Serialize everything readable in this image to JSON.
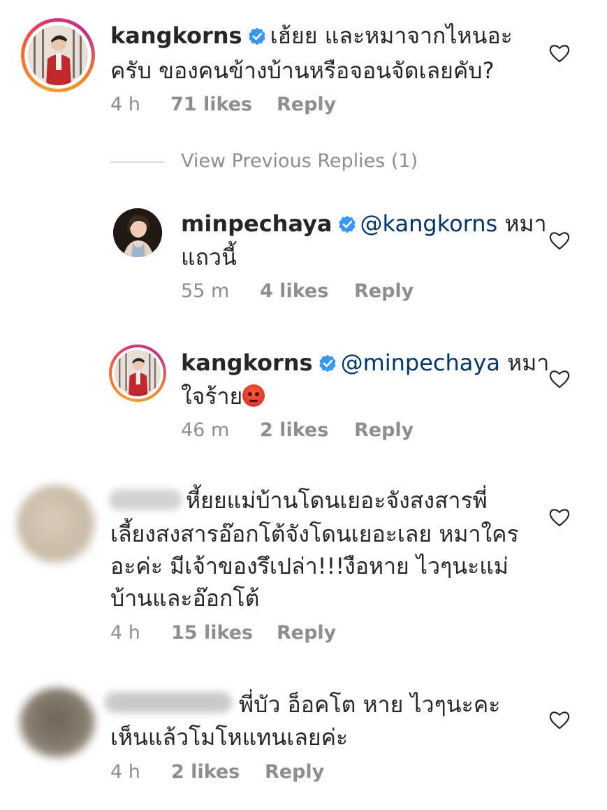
{
  "comments": [
    {
      "username": "kangkorns",
      "verified": true,
      "line1": "เฮ้ยย และหมาจากไหนอะ",
      "line2": "ครับ ของคนข้างบ้านหรือจอนจัดเลยคับ?",
      "time": "4 h",
      "likes": "71 likes",
      "reply": "Reply",
      "icon": "heart-outline-icon"
    }
  ],
  "view_previous": "View Previous Replies (1)",
  "replies": [
    {
      "username": "minpechaya",
      "verified": true,
      "mention": "@kangkorns",
      "line1_rest": " หมา",
      "line2": "แถวนี้",
      "time": "55 m",
      "likes": "4 likes",
      "reply": "Reply"
    },
    {
      "username": "kangkorns",
      "verified": true,
      "mention": "@minpechaya",
      "line1_rest": " หมา",
      "line2": "ใจร้าย",
      "emoji": "angry-face-emoji",
      "time": "46 m",
      "likes": "2 likes",
      "reply": "Reply"
    }
  ],
  "other_comments": [
    {
      "line1": "หี้ยยแม่บ้านโดนเยอะจังสงสารพี่",
      "line2": "เลี้ยงสงสารอ๊อกโต้จังโดนเยอะเลย หมาใคร",
      "line3": "อะค่ะ มีเจ้าของรึเปล่า!!!งือหาย ไวๆนะแม่",
      "line4": "บ้านและอ๊อกโต้",
      "time": "4 h",
      "likes": "15 likes",
      "reply": "Reply"
    },
    {
      "line1": "พี่บัว อ็อคโต หาย ไวๆนะคะ",
      "line2": "เห็นแล้วโมโหแทนเลยค่ะ",
      "time": "4 h",
      "likes": "2 likes",
      "reply": "Reply"
    }
  ],
  "colors": {
    "text": "#262626",
    "meta": "#8e8e8e",
    "mention": "#003569",
    "verified": "#3897f0"
  }
}
